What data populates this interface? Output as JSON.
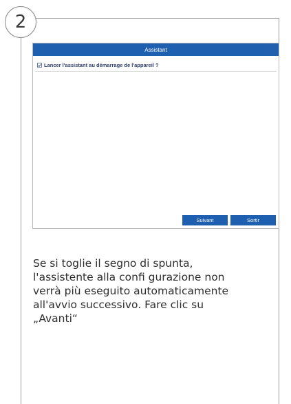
{
  "step": {
    "number": "2"
  },
  "dialog": {
    "title": "Assistant",
    "option_label": "Lancer l'assistant au démarrage de l'appareil ?",
    "option_checked": true,
    "buttons": {
      "next": "Suivant",
      "exit": "Sortir"
    },
    "accent_color": "#1f5fb0"
  },
  "caption": {
    "lines": [
      "Se si toglie il segno di spunta,",
      "l'assistente alla confi gurazione non",
      "verrà più eseguito automaticamente",
      "all'avvio successivo. Fare clic su",
      "„Avanti“"
    ]
  }
}
